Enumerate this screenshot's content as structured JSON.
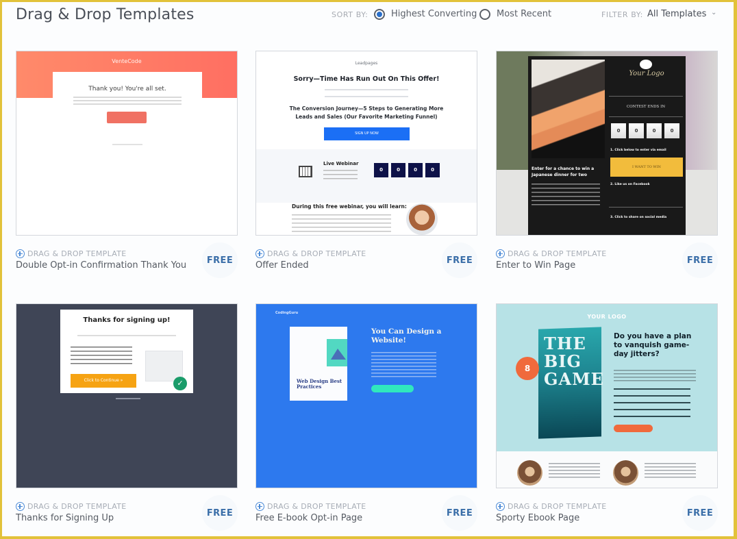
{
  "header": {
    "title": "Drag & Drop Templates",
    "sort_label": "SORT BY:",
    "sort_options": [
      {
        "label": "Highest Converting",
        "selected": true
      },
      {
        "label": "Most Recent",
        "selected": false
      }
    ],
    "filter_label": "FILTER BY:",
    "filter_value": "All Templates"
  },
  "colors": {
    "accent": "#2a6fc9",
    "price": "#3a6ea8",
    "page_border": "#e2c23a"
  },
  "templates": [
    {
      "kind": "DRAG & DROP TEMPLATE",
      "name": "Double Opt-in Confirmation Thank You",
      "price": "FREE",
      "preview": {
        "logo": "VenteCode",
        "headline": "Thank you! You're all set."
      }
    },
    {
      "kind": "DRAG & DROP TEMPLATE",
      "name": "Offer Ended",
      "price": "FREE",
      "preview": {
        "logo": "Leadpages",
        "headline": "Sorry—Time Has Run Out On This Offer!",
        "subheadline": "The Conversion Journey—5 Steps to Generating More Leads and Sales (Our Favorite Marketing Funnel)",
        "button": "SIGN UP NOW",
        "webinar_label": "Live Webinar",
        "countdown": [
          "0",
          "0",
          "0",
          "0"
        ],
        "learn_heading": "During this free webinar, you will learn:"
      }
    },
    {
      "kind": "DRAG & DROP TEMPLATE",
      "name": "Enter to Win Page",
      "price": "FREE",
      "preview": {
        "logo": "Your Logo",
        "contest": "CONTEST ENDS IN",
        "countdown": [
          "0",
          "0",
          "0",
          "0"
        ],
        "headline": "Enter for a chance to win a Japanese dinner for two",
        "step1": "1. Click below to enter via email",
        "button": "I WANT TO WIN",
        "step2": "2. Like us on Facebook",
        "step3": "3. Click to share on social media"
      }
    },
    {
      "kind": "DRAG & DROP TEMPLATE",
      "name": "Thanks for Signing Up",
      "price": "FREE",
      "preview": {
        "headline": "Thanks for signing up!",
        "button": "Click to Continue »"
      }
    },
    {
      "kind": "DRAG & DROP TEMPLATE",
      "name": "Free E-book Opt-in Page",
      "price": "FREE",
      "preview": {
        "logo": "CodingGuru",
        "headline": "You Can Design a Website!",
        "book_title": "Web Design Best Practices"
      }
    },
    {
      "kind": "DRAG & DROP TEMPLATE",
      "name": "Sporty Ebook Page",
      "price": "FREE",
      "preview": {
        "logo": "YOUR LOGO",
        "headline": "Do you have a plan to vanquish game-day jitters?",
        "book_title": "THE BIG GAME",
        "badge": "8"
      }
    }
  ]
}
